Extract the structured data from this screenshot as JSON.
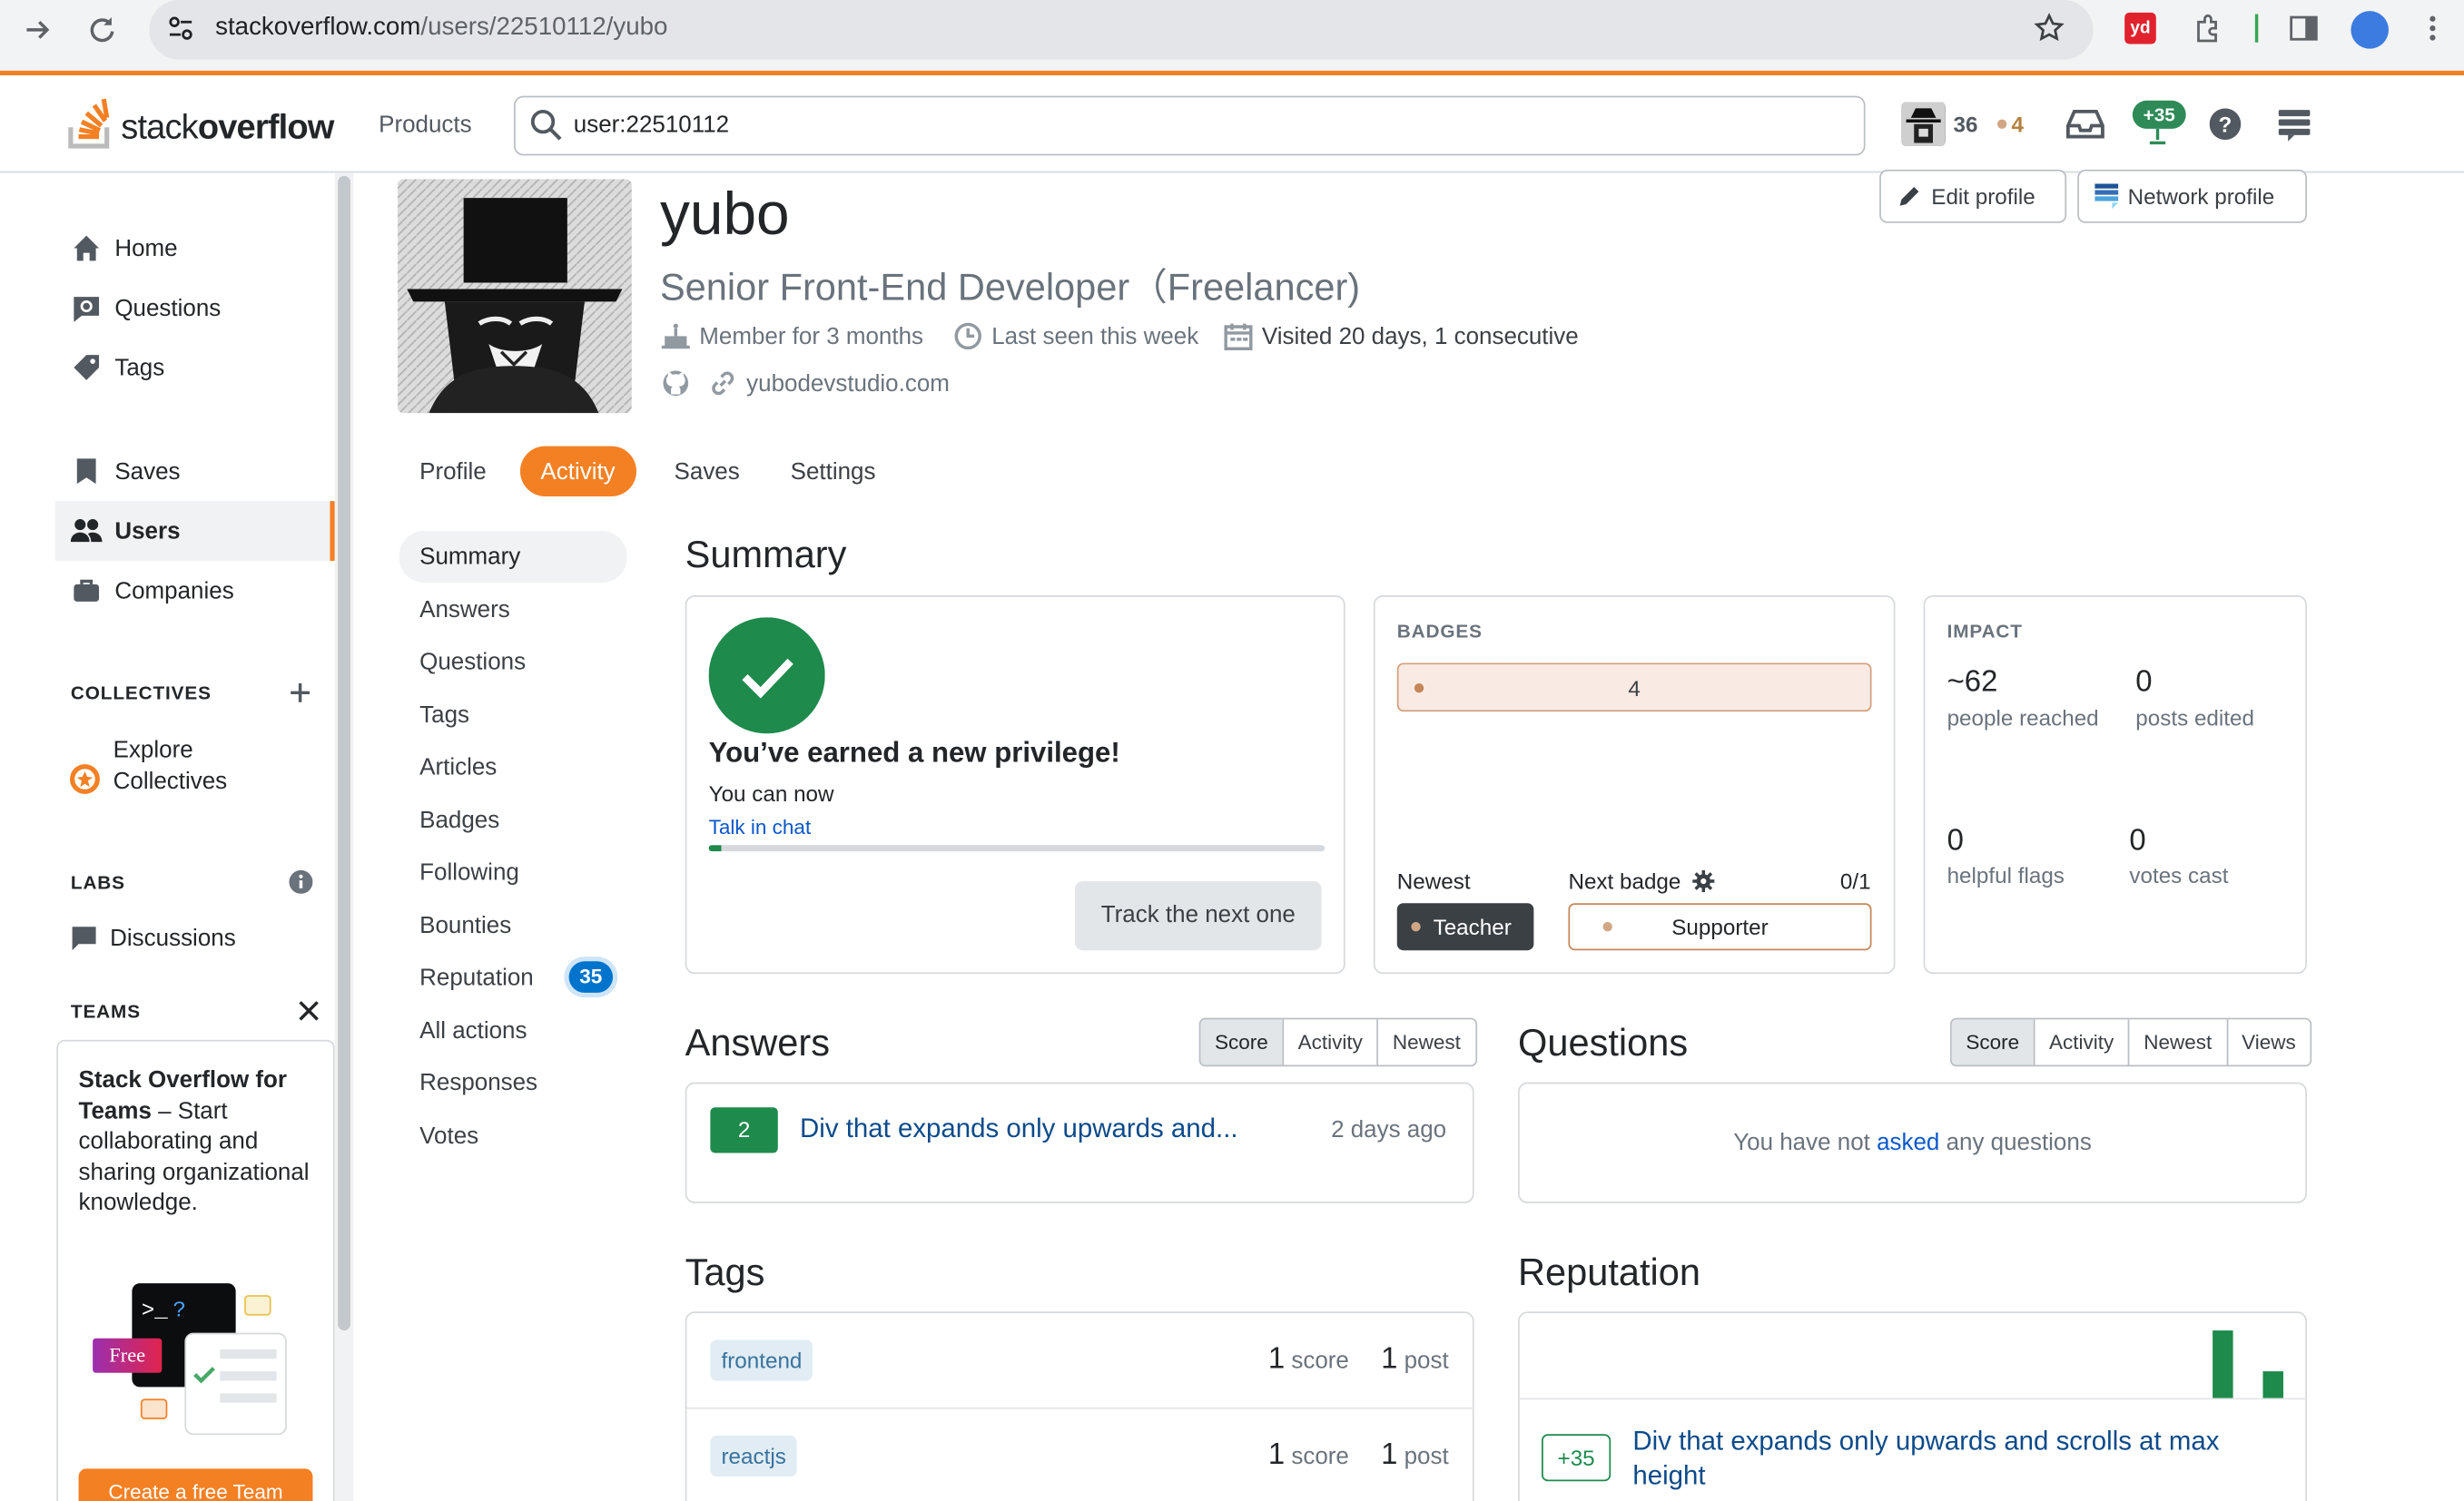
{
  "browser": {
    "url_domain": "stackoverflow.com",
    "url_path": "/users/22510112/yubo"
  },
  "header": {
    "logo_light": "stack",
    "logo_bold": "overflow",
    "products": "Products",
    "search_value": "user:22510112",
    "reputation": "36",
    "bronze_badges": "4",
    "rep_change": "+35"
  },
  "sidebar": {
    "items": [
      {
        "label": "Home",
        "icon": "home-icon"
      },
      {
        "label": "Questions",
        "icon": "questions-icon"
      },
      {
        "label": "Tags",
        "icon": "tag-icon"
      },
      {
        "label": "Saves",
        "icon": "bookmark-icon"
      },
      {
        "label": "Users",
        "icon": "users-icon"
      },
      {
        "label": "Companies",
        "icon": "briefcase-icon"
      }
    ],
    "collectives_heading": "COLLECTIVES",
    "explore_collectives_1": "Explore",
    "explore_collectives_2": "Collectives",
    "labs_heading": "LABS",
    "discussions": "Discussions",
    "teams_heading": "TEAMS",
    "teams_card_title": "Stack Overflow for Teams",
    "teams_card_body": " – Start collaborating and sharing organizational knowledge.",
    "free_badge": "Free",
    "create_team": "Create a free Team"
  },
  "profile": {
    "name": "yubo",
    "title": "Senior Front-End Developer（Freelancer)",
    "member_for": "Member for 3 months",
    "last_seen": "Last seen this week",
    "visited": "Visited 20 days, 1 consecutive",
    "website": "yubodevstudio.com",
    "edit_profile": "Edit profile",
    "network_profile": "Network profile"
  },
  "tabs": [
    "Profile",
    "Activity",
    "Saves",
    "Settings"
  ],
  "subnav": [
    "Summary",
    "Answers",
    "Questions",
    "Tags",
    "Articles",
    "Badges",
    "Following",
    "Bounties",
    "Reputation",
    "All actions",
    "Responses",
    "Votes"
  ],
  "subnav_reputation_count": "35",
  "summary": {
    "heading": "Summary",
    "privilege_title": "You’ve earned a new privilege!",
    "privilege_sub": "You can now",
    "privilege_link": "Talk in chat",
    "privilege_progress": 0.02,
    "track_button": "Track the next one",
    "badges_label": "BADGES",
    "bronze_count": "4",
    "newest_label": "Newest",
    "newest_badge": "Teacher",
    "next_badge_label": "Next badge",
    "next_badge_progress": "0/1",
    "next_badge": "Supporter",
    "impact_label": "IMPACT",
    "people_reached": "~62",
    "people_reached_label": "people reached",
    "posts_edited": "0",
    "posts_edited_label": "posts edited",
    "helpful_flags": "0",
    "helpful_flags_label": "helpful flags",
    "votes_cast": "0",
    "votes_cast_label": "votes cast"
  },
  "answers": {
    "heading": "Answers",
    "sorts": [
      "Score",
      "Activity",
      "Newest"
    ],
    "items": [
      {
        "score": "2",
        "title": "Div that expands only upwards and...",
        "time": "2 days ago"
      }
    ]
  },
  "questions": {
    "heading": "Questions",
    "sorts": [
      "Score",
      "Activity",
      "Newest",
      "Views"
    ],
    "empty_pre": "You have not ",
    "empty_link": "asked",
    "empty_post": " any questions"
  },
  "tags": {
    "heading": "Tags",
    "items": [
      {
        "name": "frontend",
        "score": "1",
        "score_label": "score",
        "posts": "1",
        "posts_label": "post"
      },
      {
        "name": "reactjs",
        "score": "1",
        "score_label": "score",
        "posts": "1",
        "posts_label": "post"
      }
    ]
  },
  "reputation": {
    "heading": "Reputation",
    "bars": [
      0.9,
      0.35
    ],
    "event_change": "+35",
    "event_title": "Div that expands only upwards and scrolls at max height"
  }
}
